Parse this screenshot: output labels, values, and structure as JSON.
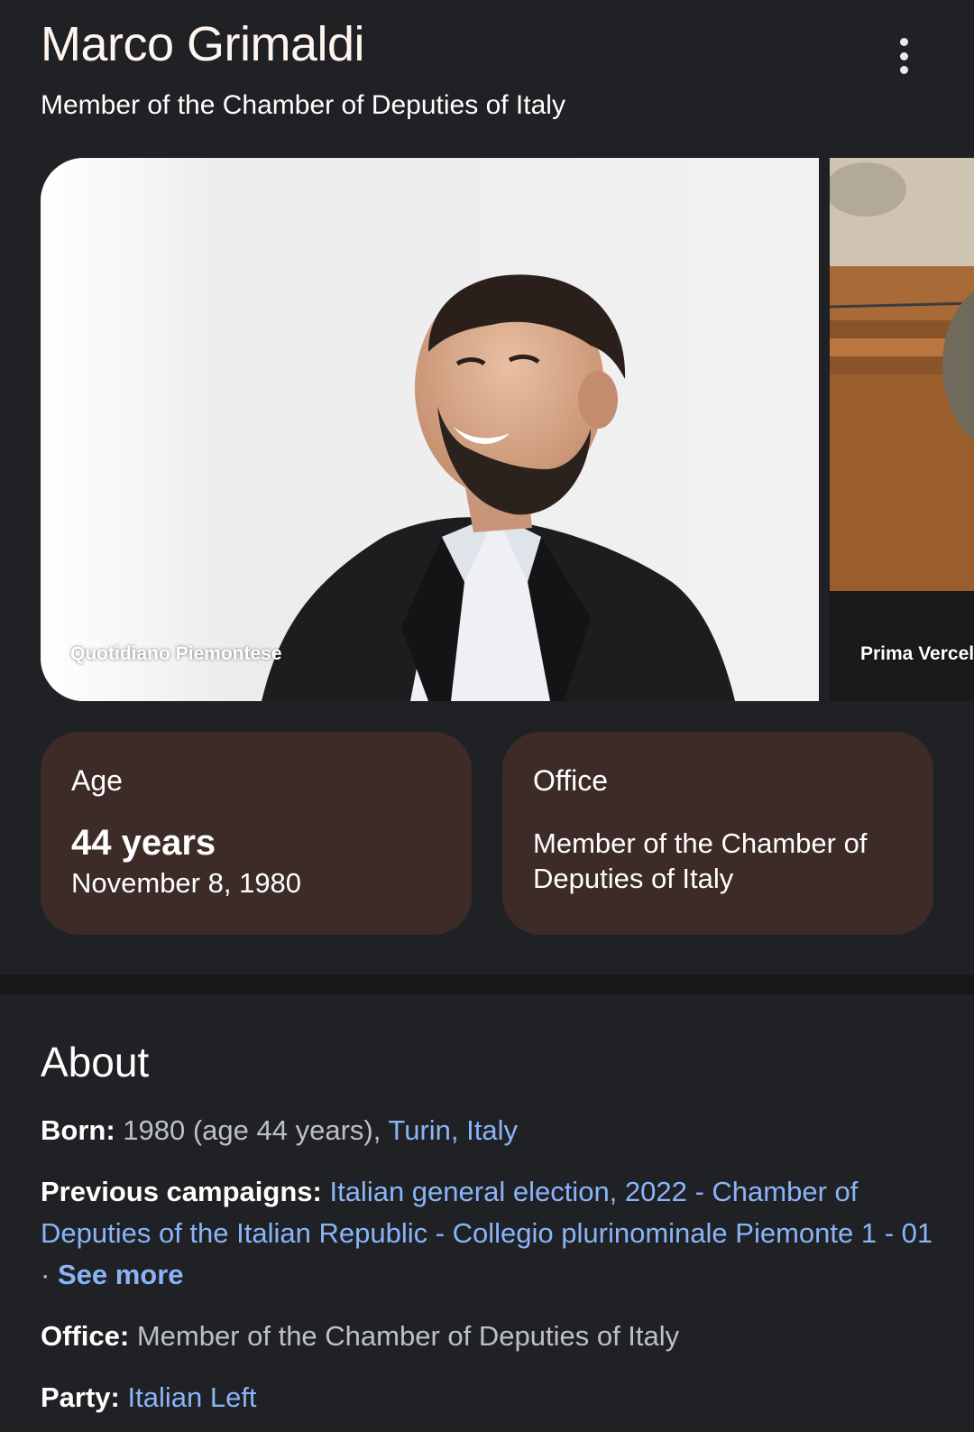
{
  "header": {
    "title": "Marco Grimaldi",
    "subtitle": "Member of the Chamber of Deputies of Italy",
    "menu_icon": "more-vert-icon"
  },
  "photos": [
    {
      "credit": "Quotidiano Piemontese"
    },
    {
      "credit": "Prima Vercel"
    }
  ],
  "cards": {
    "age": {
      "label": "Age",
      "value": "44 years",
      "detail": "November 8, 1980"
    },
    "office": {
      "label": "Office",
      "value": "Member of the Chamber of Deputies of Italy"
    }
  },
  "about": {
    "title": "About",
    "born": {
      "key": "Born:",
      "text": "1980 (age 44 years),",
      "link": "Turin, Italy"
    },
    "campaigns": {
      "key": "Previous campaigns:",
      "link": "Italian general election, 2022 - Chamber of Deputies of the Italian Republic - Collegio plurinominale Piemonte 1 - 01",
      "separator": "·",
      "see_more": "See more"
    },
    "office": {
      "key": "Office:",
      "text": "Member of the Chamber of Deputies of Italy"
    },
    "party": {
      "key": "Party:",
      "link": "Italian Left"
    }
  },
  "colors": {
    "background": "#202124",
    "card": "#3c2b27",
    "link": "#8ab4f8"
  }
}
